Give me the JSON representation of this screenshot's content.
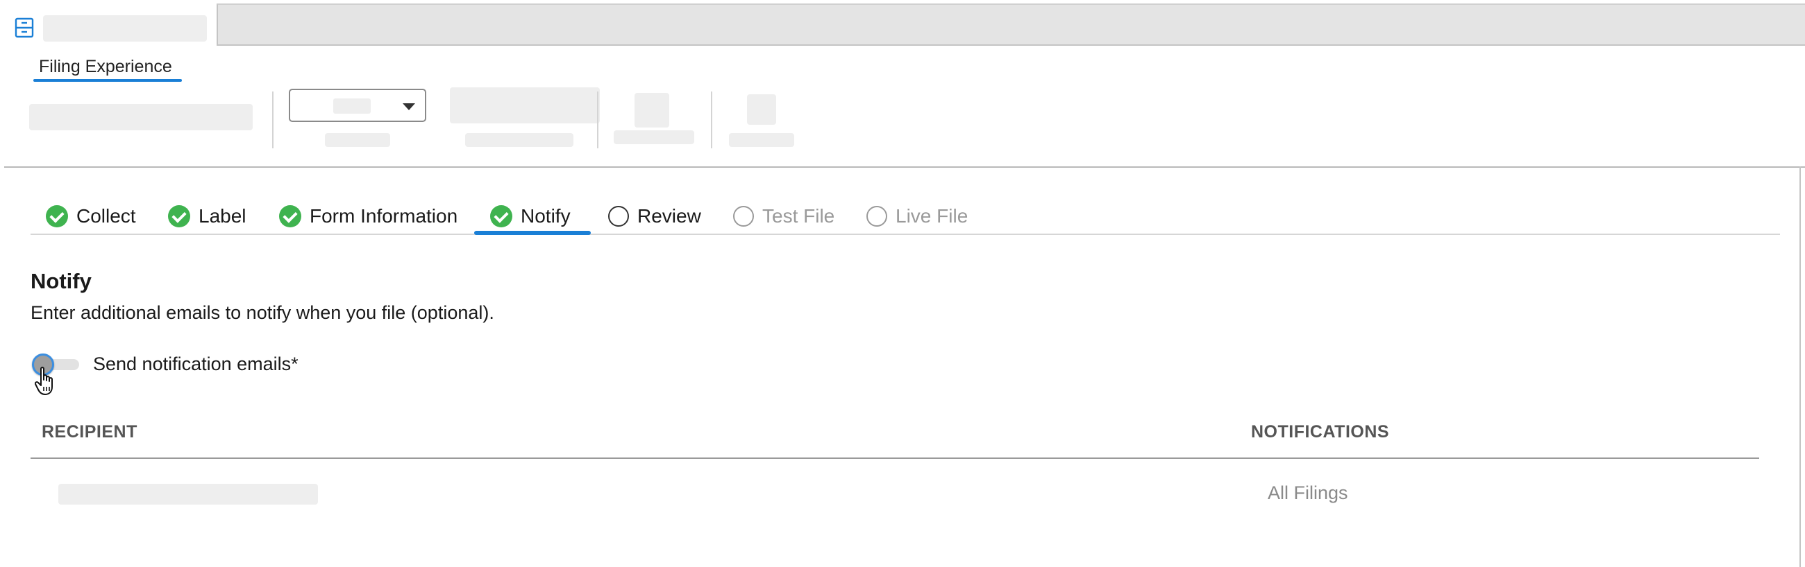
{
  "window": {
    "subtab_label": "Filing Experience"
  },
  "stepper": {
    "steps": [
      {
        "label": "Collect",
        "state": "done"
      },
      {
        "label": "Label",
        "state": "done"
      },
      {
        "label": "Form Information",
        "state": "done"
      },
      {
        "label": "Notify",
        "state": "done-active"
      },
      {
        "label": "Review",
        "state": "pending"
      },
      {
        "label": "Test File",
        "state": "disabled"
      },
      {
        "label": "Live File",
        "state": "disabled"
      }
    ]
  },
  "notify": {
    "title": "Notify",
    "description": "Enter additional emails to notify when you file (optional).",
    "toggle_label": "Send notification emails*",
    "toggle_on": false
  },
  "table": {
    "columns": [
      "RECIPIENT",
      "NOTIFICATIONS"
    ],
    "rows": [
      {
        "recipient": "",
        "notifications": "All Filings"
      }
    ]
  },
  "colors": {
    "accent": "#1a7fd6",
    "success": "#3fb34f",
    "muted": "#9a9a9a"
  }
}
